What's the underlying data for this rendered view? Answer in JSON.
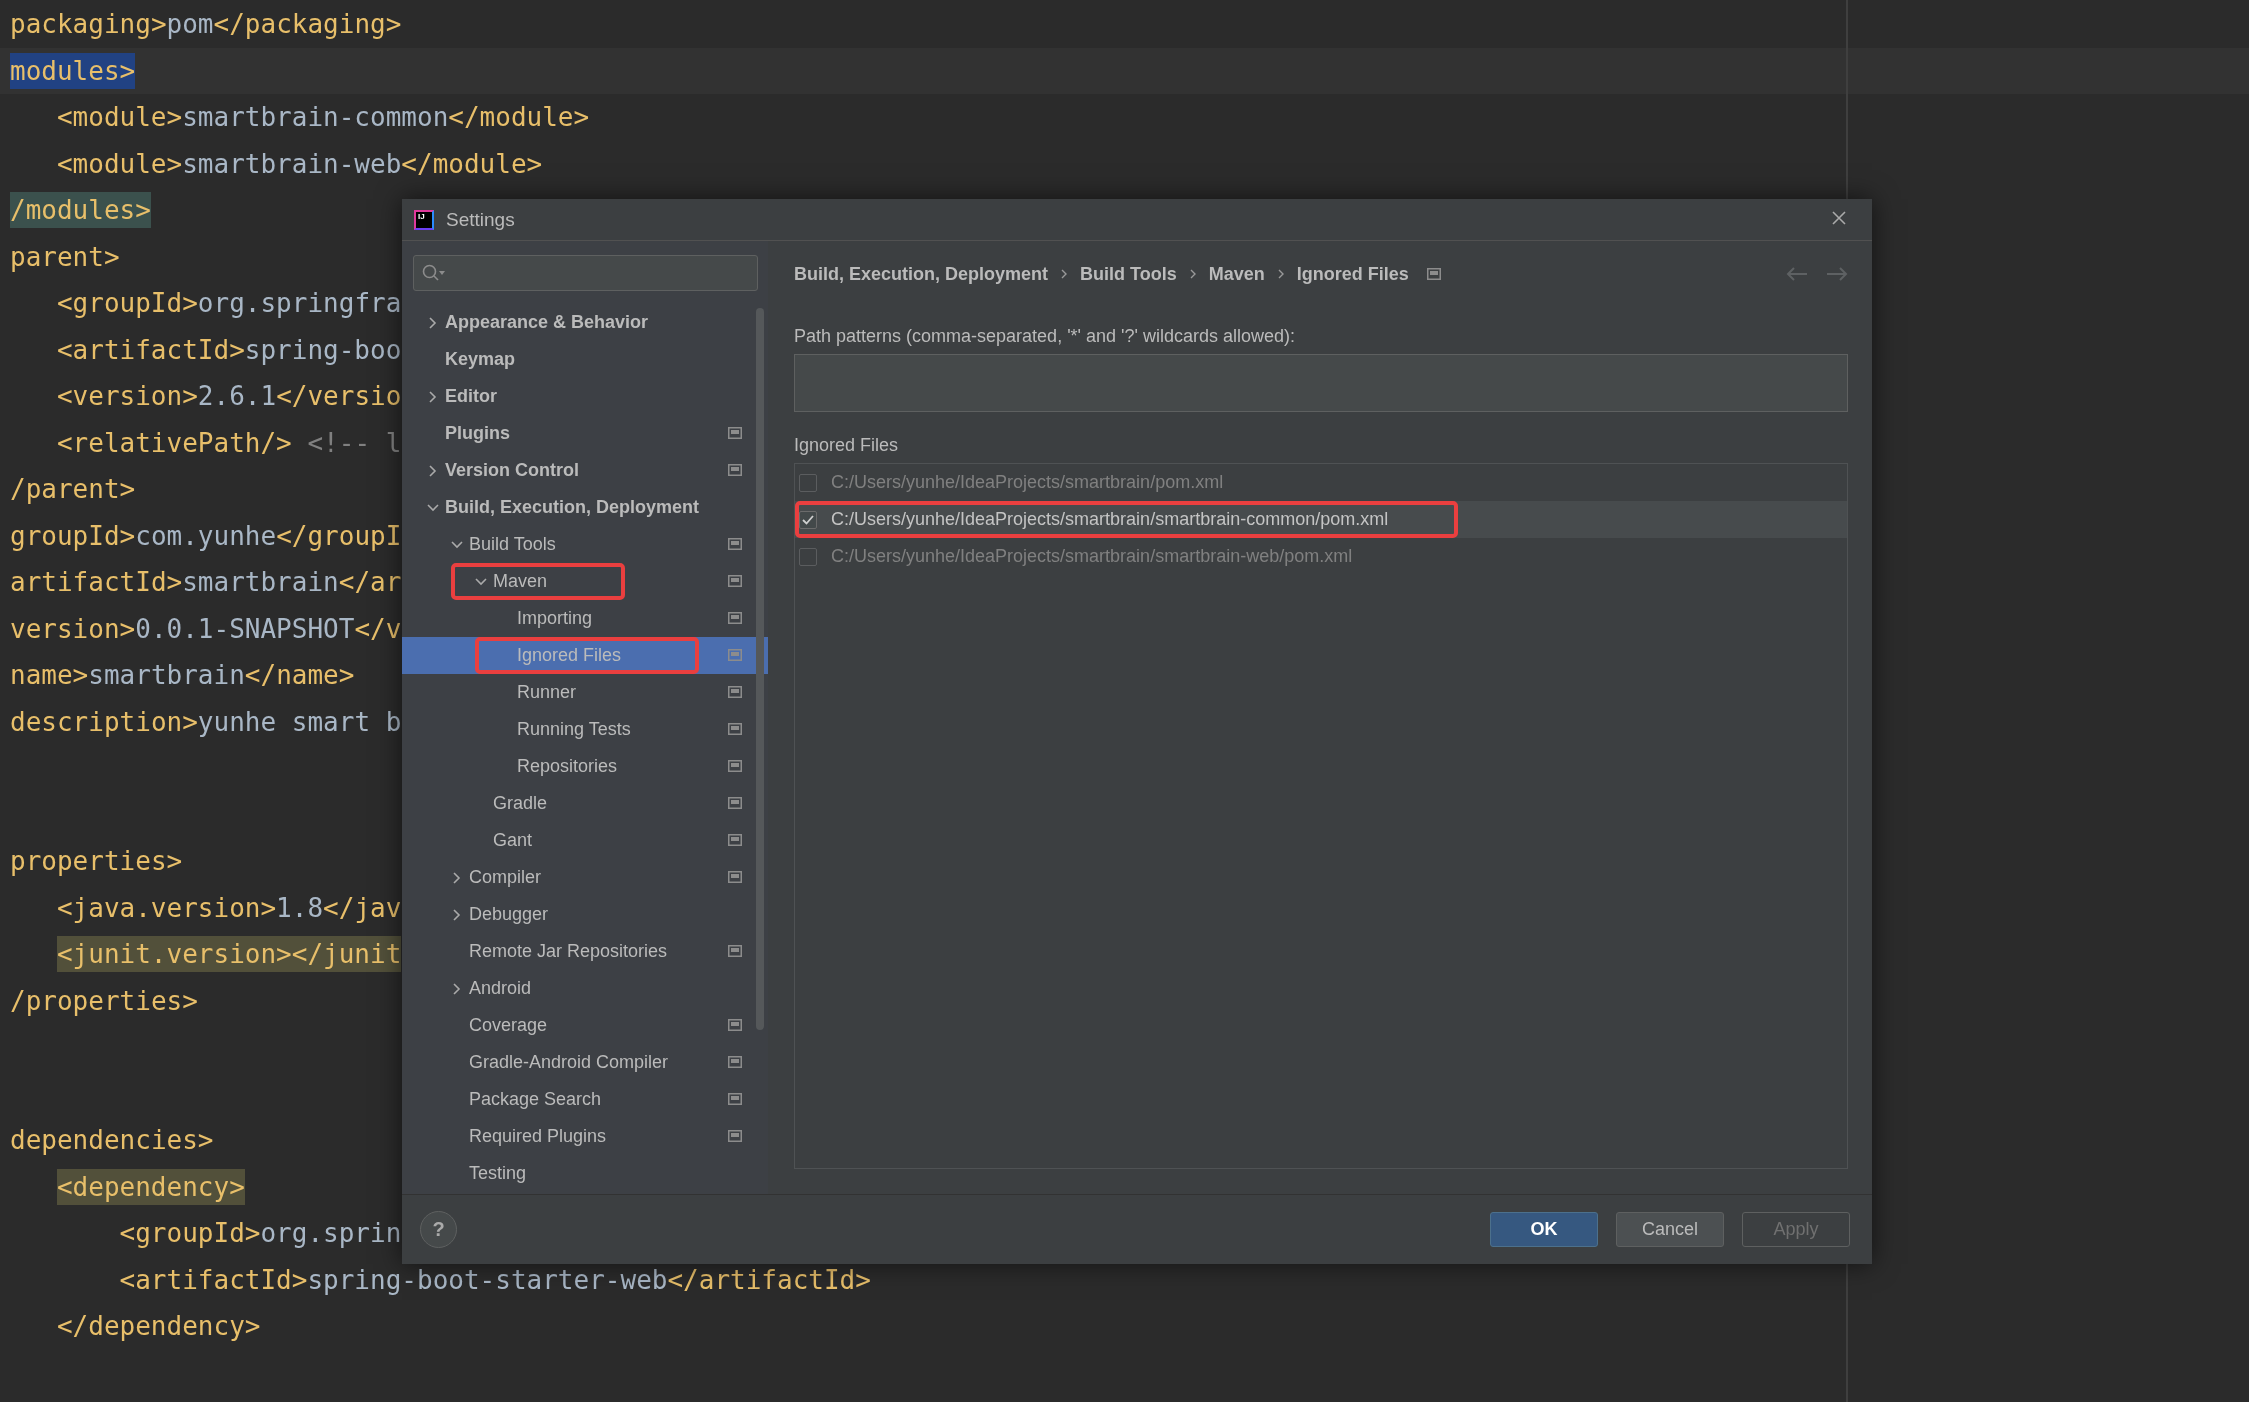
{
  "editor": {
    "lines": [
      {
        "text": "packaging>pom</packaging>",
        "current": false
      },
      {
        "text": "modules>",
        "current": true,
        "color": "#214283"
      },
      {
        "text": "   <module>smartbrain-common</module>",
        "current": false
      },
      {
        "text": "   <module>smartbrain-web</module>",
        "current": false
      },
      {
        "text": "/modules>",
        "current": false,
        "color": "#3b514d"
      },
      {
        "text": "parent>",
        "current": false
      },
      {
        "text": "   <groupId>org.springfra",
        "current": false
      },
      {
        "text": "   <artifactId>spring-boo",
        "current": false
      },
      {
        "text": "   <version>2.6.1</versio",
        "current": false
      },
      {
        "text": "   <relativePath/> <!-- l",
        "current": false
      },
      {
        "text": "/parent>",
        "current": false
      },
      {
        "text": "groupId>com.yunhe</groupI",
        "current": false
      },
      {
        "text": "artifactId>smartbrain</ar",
        "current": false
      },
      {
        "text": "version>0.0.1-SNAPSHOT</v",
        "current": false
      },
      {
        "text": "name>smartbrain</name>",
        "current": false
      },
      {
        "text": "description>yunhe smart b",
        "current": false
      },
      {
        "kind": "blank"
      },
      {
        "kind": "blank"
      },
      {
        "text": "properties>",
        "current": false
      },
      {
        "text": "   <java.version>1.8</jav",
        "current": false
      },
      {
        "text": "   <junit.version></junit",
        "current": false,
        "color": "#52503a"
      },
      {
        "text": "/properties>",
        "current": false
      },
      {
        "kind": "blank"
      },
      {
        "kind": "blank"
      },
      {
        "text": "dependencies>",
        "current": false
      },
      {
        "text": "   <dependency>",
        "current": false,
        "color": "#52503a"
      },
      {
        "text": "       <groupId>org.sprin",
        "current": false
      },
      {
        "text": "       <artifactId>spring-boot-starter-web</artifactId>",
        "current": false
      },
      {
        "text": "   </dependency>",
        "current": false
      }
    ]
  },
  "dialog": {
    "logo": "IJ",
    "title": "Settings",
    "tree": [
      {
        "label": "Appearance & Behavior",
        "expanded": false,
        "selected": false,
        "project_settings": false,
        "framed": false
      },
      {
        "label": "Keymap",
        "selected": false,
        "project_settings": false,
        "framed": false
      },
      {
        "label": "Editor",
        "expanded": false,
        "selected": false,
        "project_settings": false,
        "framed": false
      },
      {
        "label": "Plugins",
        "selected": false,
        "project_settings": true,
        "framed": false
      },
      {
        "label": "Version Control",
        "expanded": false,
        "selected": false,
        "project_settings": true,
        "framed": false
      },
      {
        "label": "Build, Execution, Deployment",
        "expanded": true,
        "selected": false,
        "project_settings": false,
        "framed": false,
        "children": [
          {
            "label": "Build Tools",
            "expanded": true,
            "selected": false,
            "project_settings": true,
            "framed": false,
            "children": [
              {
                "label": "Maven",
                "expanded": true,
                "selected": false,
                "project_settings": true,
                "framed": true,
                "children": [
                  {
                    "label": "Importing",
                    "selected": false,
                    "project_settings": true,
                    "framed": false
                  },
                  {
                    "label": "Ignored Files",
                    "selected": true,
                    "project_settings": true,
                    "framed": true
                  },
                  {
                    "label": "Runner",
                    "selected": false,
                    "project_settings": true,
                    "framed": false
                  },
                  {
                    "label": "Running Tests",
                    "selected": false,
                    "project_settings": true,
                    "framed": false
                  },
                  {
                    "label": "Repositories",
                    "selected": false,
                    "project_settings": true,
                    "framed": false
                  }
                ]
              },
              {
                "label": "Gradle",
                "selected": false,
                "project_settings": true,
                "framed": false
              },
              {
                "label": "Gant",
                "selected": false,
                "project_settings": true,
                "framed": false
              }
            ]
          },
          {
            "label": "Compiler",
            "expanded": false,
            "selected": false,
            "project_settings": true,
            "framed": false
          },
          {
            "label": "Debugger",
            "expanded": false,
            "selected": false,
            "project_settings": false,
            "framed": false
          },
          {
            "label": "Remote Jar Repositories",
            "selected": false,
            "project_settings": true,
            "framed": false
          },
          {
            "label": "Android",
            "expanded": false,
            "selected": false,
            "project_settings": false,
            "framed": false
          },
          {
            "label": "Coverage",
            "selected": false,
            "project_settings": true,
            "framed": false
          },
          {
            "label": "Gradle-Android Compiler",
            "selected": false,
            "project_settings": true,
            "framed": false
          },
          {
            "label": "Package Search",
            "selected": false,
            "project_settings": true,
            "framed": false
          },
          {
            "label": "Required Plugins",
            "selected": false,
            "project_settings": true,
            "framed": false
          },
          {
            "label": "Testing",
            "selected": false,
            "project_settings": false,
            "framed": false
          }
        ]
      }
    ],
    "breadcrumb": [
      "Build, Execution, Deployment",
      "Build Tools",
      "Maven",
      "Ignored Files"
    ],
    "patterns_label": "Path patterns (comma-separated, '*' and '?' wildcards allowed):",
    "files_label": "Ignored Files",
    "files": [
      {
        "path": "C:/Users/yunhe/IdeaProjects/smartbrain/pom.xml",
        "checked": false,
        "selected": false,
        "framed": false
      },
      {
        "path": "C:/Users/yunhe/IdeaProjects/smartbrain/smartbrain-common/pom.xml",
        "checked": true,
        "selected": true,
        "framed": true
      },
      {
        "path": "C:/Users/yunhe/IdeaProjects/smartbrain/smartbrain-web/pom.xml",
        "checked": false,
        "selected": false,
        "framed": false
      }
    ],
    "help": "?",
    "buttons": [
      {
        "label": "OK",
        "kind": "default",
        "disabled": false
      },
      {
        "label": "Cancel",
        "kind": "normal",
        "disabled": false
      },
      {
        "label": "Apply",
        "kind": "normal",
        "disabled": true
      }
    ]
  }
}
